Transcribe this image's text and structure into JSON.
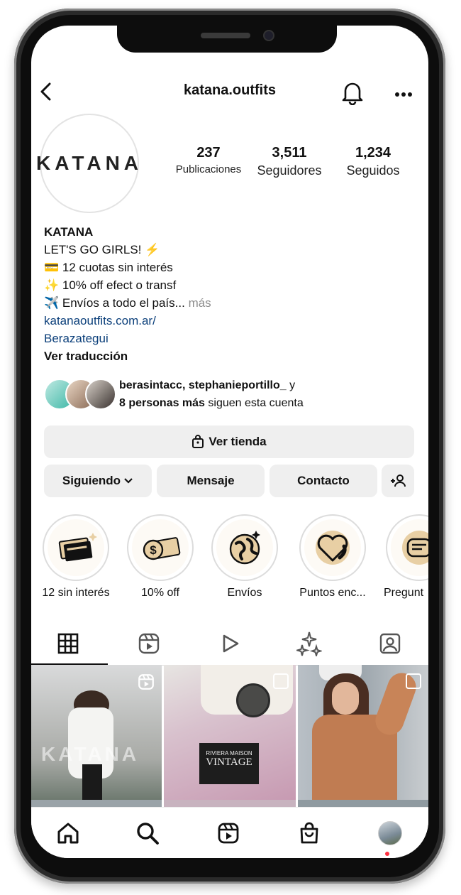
{
  "header": {
    "username": "katana.outfits"
  },
  "profile": {
    "avatar_text": "KATANA",
    "stats": [
      {
        "value": "237",
        "label": "Publicaciones"
      },
      {
        "value": "3,511",
        "label": "Seguidores"
      },
      {
        "value": "1,234",
        "label": "Seguidos"
      }
    ],
    "bio": {
      "name": "KATANA",
      "line1": "LET'S GO GIRLS! ⚡",
      "line2": "💳 12 cuotas sin interés",
      "line3": "✨ 10% off efect o transf",
      "line4": "✈️ Envíos a todo el país...",
      "more": " más",
      "link": "katanaoutfits.com.ar/",
      "location": "Berazategui",
      "translate": "Ver traducción"
    },
    "followed_by": {
      "line1_users": "berasintacc, stephanieportillo_",
      "line1_tail": " y",
      "line2_bold": "8 personas más",
      "line2_tail": " siguen esta cuenta"
    }
  },
  "buttons": {
    "shop": "Ver tienda",
    "following": "Siguiendo",
    "message": "Mensaje",
    "contact": "Contacto"
  },
  "highlights": [
    {
      "label": "12 sin interés",
      "icon": "card-icon"
    },
    {
      "label": "10% off",
      "icon": "money-icon"
    },
    {
      "label": "Envíos",
      "icon": "globe-icon"
    },
    {
      "label": "Puntos enc...",
      "icon": "heart-icon"
    },
    {
      "label": "Pregunt",
      "icon": "chat-icon"
    }
  ],
  "grid_photo_text": {
    "cell1": "KATANA",
    "cell2a": "RIVIERA MAISON",
    "cell2b": "VINTAGE"
  },
  "colors": {
    "link": "#0b3f7a",
    "button_bg": "#efefef",
    "notification_dot": "#ff3040",
    "highlight_tan": "#e8cfa4"
  }
}
